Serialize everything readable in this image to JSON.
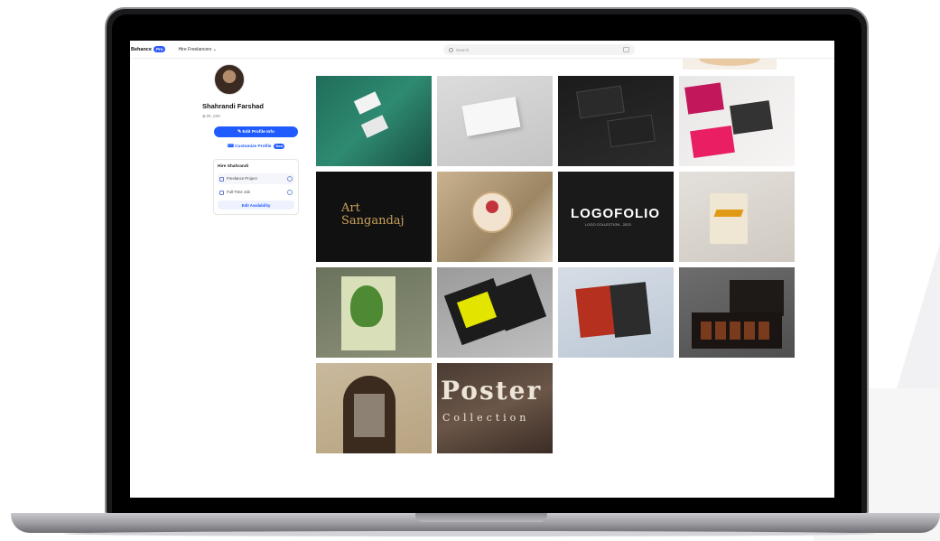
{
  "topbar": {
    "brand": "Behance",
    "brand_badge": "Pro",
    "freelancers": "Hire Freelancers ⌄",
    "search_placeholder": "Search"
  },
  "profile": {
    "name": "Shahrandi Farshad",
    "location": "⊕ IR, CRI",
    "edit_button": "✎ Edit Profile Info",
    "customize_button": "⌨ Customize Profile",
    "customize_badge": "New"
  },
  "hire_card": {
    "title": "Hire Shahrandi",
    "options": [
      {
        "label": "Freelance Project"
      },
      {
        "label": "Full-Time Job"
      }
    ],
    "availability_button": "Edit Availability"
  },
  "projects": [
    {
      "name": "Business card mockup green"
    },
    {
      "name": "Business card white"
    },
    {
      "name": "Business card black"
    },
    {
      "name": "Brochure spread"
    },
    {
      "name": "Art Sangandaj",
      "text": "Art Sangandaj"
    },
    {
      "name": "Embroidery Brina"
    },
    {
      "name": "Logofolio",
      "text": "LOGOFOLIO",
      "subtext": "LOGO COLLECTION - 2023"
    },
    {
      "name": "Tote bag branding"
    },
    {
      "name": "Green number poster"
    },
    {
      "name": "Typography posters"
    },
    {
      "name": "Food magazine"
    },
    {
      "name": "Chocolate box packaging"
    },
    {
      "name": "Arch poster"
    },
    {
      "name": "Poster collection",
      "text": "Poster",
      "subtext": "Collection"
    }
  ],
  "colors": {
    "accent": "#1f5bff",
    "laptop_bezel": "#1a1a1c"
  }
}
